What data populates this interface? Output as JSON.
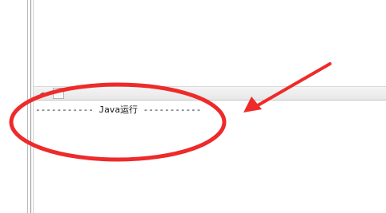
{
  "console": {
    "line": "----------- Java运行 -----------"
  },
  "icons": {
    "toggle": "triangle-left",
    "pane": "square"
  },
  "colors": {
    "annotation": "#ee2a2a",
    "pane_header": "#eeeeee"
  }
}
